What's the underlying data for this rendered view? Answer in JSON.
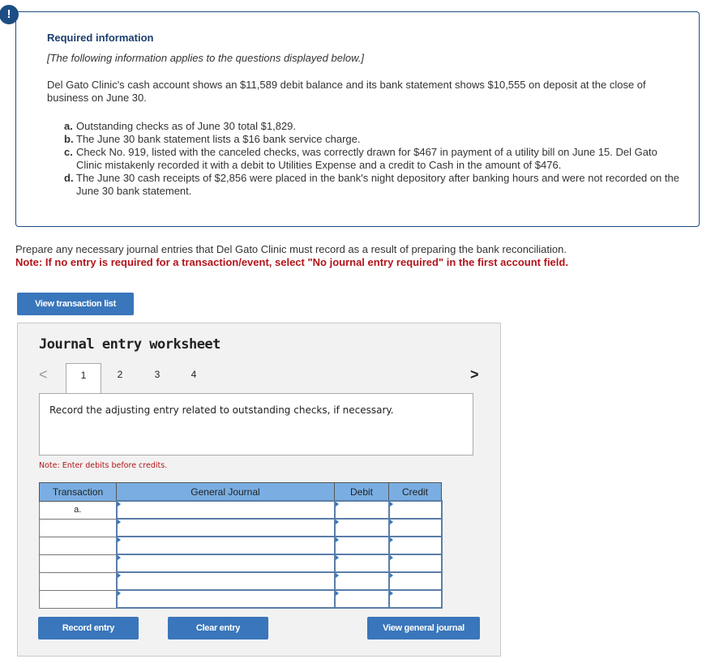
{
  "alert_icon": "!",
  "info": {
    "title": "Required information",
    "subtitle": "[The following information applies to the questions displayed below.]",
    "paragraph": "Del Gato Clinic's cash account shows an $11,589 debit balance and its bank statement shows $10,555 on deposit at the close of business on June 30.",
    "items": [
      {
        "label": "a.",
        "text": "Outstanding checks as of June 30 total $1,829."
      },
      {
        "label": "b.",
        "text": "The June 30 bank statement lists a $16 bank service charge."
      },
      {
        "label": "c.",
        "text": "Check No. 919, listed with the canceled checks, was correctly drawn for $467 in payment of a utility bill on June 15. Del Gato Clinic mistakenly recorded it with a debit to Utilities Expense and a credit to Cash in the amount of $476."
      },
      {
        "label": "d.",
        "text": "The June 30 cash receipts of $2,856 were placed in the bank's night depository after banking hours and were not recorded on the June 30 bank statement."
      }
    ]
  },
  "instructions": "Prepare any necessary journal entries that Del Gato Clinic must record as a result of preparing the bank reconciliation.",
  "note": "Note: If no entry is required for a transaction/event, select \"No journal entry required\" in the first account field.",
  "buttons": {
    "view_transaction_list": "View transaction list",
    "record_entry": "Record entry",
    "clear_entry": "Clear entry",
    "view_general_journal": "View general journal"
  },
  "worksheet": {
    "title": "Journal entry worksheet",
    "prev_icon": "<",
    "next_icon": ">",
    "tabs": [
      "1",
      "2",
      "3",
      "4"
    ],
    "active_tab": "1",
    "prompt": "Record the adjusting entry related to outstanding checks, if necessary.",
    "note": "Note: Enter debits before credits.",
    "table": {
      "headers": [
        "Transaction",
        "General Journal",
        "Debit",
        "Credit"
      ],
      "rows": [
        {
          "transaction": "a.",
          "account": "",
          "debit": "",
          "credit": ""
        },
        {
          "transaction": "",
          "account": "",
          "debit": "",
          "credit": ""
        },
        {
          "transaction": "",
          "account": "",
          "debit": "",
          "credit": ""
        },
        {
          "transaction": "",
          "account": "",
          "debit": "",
          "credit": ""
        },
        {
          "transaction": "",
          "account": "",
          "debit": "",
          "credit": ""
        },
        {
          "transaction": "",
          "account": "",
          "debit": "",
          "credit": ""
        }
      ]
    }
  }
}
